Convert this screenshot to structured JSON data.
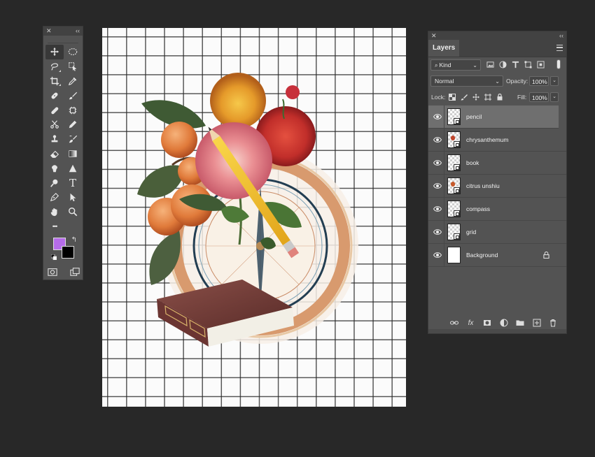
{
  "colors": {
    "foreground": "#b56ce9",
    "background": "#000000",
    "workspace": "#282828",
    "panel": "#535353",
    "selected_layer": "#6f6f6f"
  },
  "tools": {
    "close_label": "✕",
    "collapse_label": "‹‹",
    "items": [
      {
        "name": "move",
        "active": true
      },
      {
        "name": "elliptical-marquee"
      },
      {
        "name": "lasso"
      },
      {
        "name": "object-selection"
      },
      {
        "name": "crop"
      },
      {
        "name": "eyedropper"
      },
      {
        "name": "spot-healing"
      },
      {
        "name": "brush"
      },
      {
        "name": "clone-stamp"
      },
      {
        "name": "history-brush"
      },
      {
        "name": "scissors"
      },
      {
        "name": "pencil"
      },
      {
        "name": "stamp"
      },
      {
        "name": "mixer-brush"
      },
      {
        "name": "eraser"
      },
      {
        "name": "gradient"
      },
      {
        "name": "smudge"
      },
      {
        "name": "triangle"
      },
      {
        "name": "dodge"
      },
      {
        "name": "type"
      },
      {
        "name": "pen"
      },
      {
        "name": "path-selection"
      },
      {
        "name": "hand"
      },
      {
        "name": "zoom"
      },
      {
        "name": "more"
      }
    ],
    "type_glyph": "T",
    "more_glyph": "•••"
  },
  "layers_panel": {
    "close_label": "✕",
    "collapse_label": "‹‹",
    "tab_title": "Layers",
    "filter_kind": "Kind",
    "blend_mode": "Normal",
    "opacity_label": "Opacity:",
    "opacity_value": "100%",
    "lock_label": "Lock:",
    "fill_label": "Fill:",
    "fill_value": "100%",
    "layers": [
      {
        "name": "pencil",
        "selected": true,
        "thumb": "transparent",
        "mark": ""
      },
      {
        "name": "chrysanthemum",
        "thumb": "transparent",
        "mark": "#c0452c"
      },
      {
        "name": "book",
        "thumb": "transparent",
        "mark": ""
      },
      {
        "name": "citrus unshiu",
        "thumb": "transparent",
        "mark": "#c75a2c"
      },
      {
        "name": "compass",
        "thumb": "transparent",
        "mark": ""
      },
      {
        "name": "grid",
        "thumb": "transparent",
        "mark": ""
      },
      {
        "name": "Background",
        "thumb": "solid",
        "locked": true,
        "mark": ""
      }
    ]
  }
}
